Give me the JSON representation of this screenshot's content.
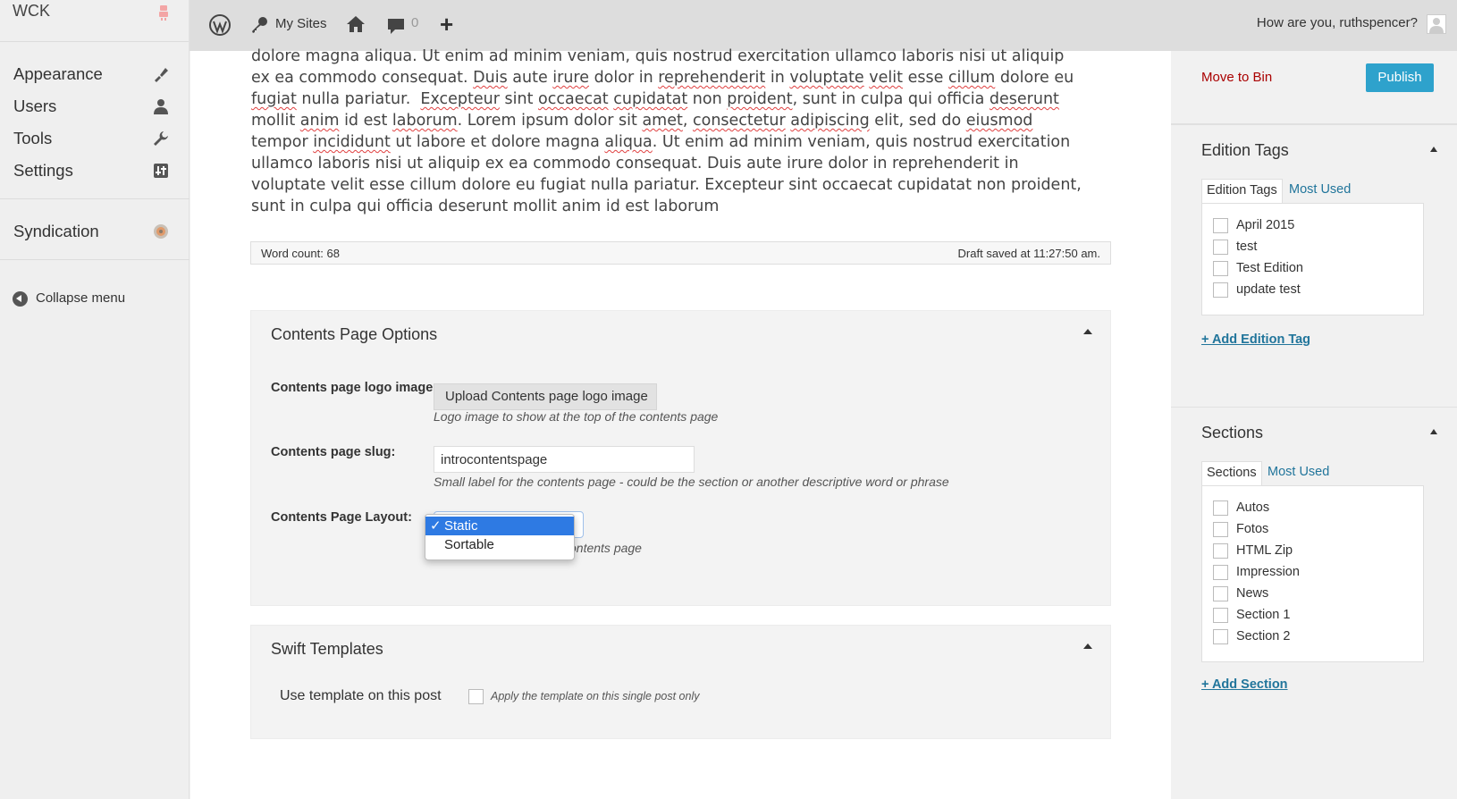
{
  "sidebar": {
    "top_label": "WCK",
    "items": [
      {
        "label": "Appearance",
        "icon": "paintbrush-icon"
      },
      {
        "label": "Users",
        "icon": "user-icon"
      },
      {
        "label": "Tools",
        "icon": "wrench-icon"
      },
      {
        "label": "Settings",
        "icon": "settings-icon"
      },
      {
        "label": "Syndication",
        "icon": "syndication-icon"
      }
    ],
    "collapse_label": "Collapse menu"
  },
  "topbar": {
    "my_sites": "My Sites",
    "comment_count": "0",
    "greeting": "How are you, ruthspencer?"
  },
  "editor": {
    "word_count": "Word count: 68",
    "draft_status": "Draft saved at 11:27:50 am."
  },
  "contents_options": {
    "title": "Contents Page Options",
    "logo_label": "Contents page logo image:",
    "logo_button": "Upload Contents page logo image",
    "logo_desc": "Logo image to show at the top of the contents page",
    "slug_label": "Contents page slug:",
    "slug_value": "introcontentspage",
    "slug_desc": "Small label for the contents page - could be the section or another descriptive word or phrase",
    "layout_label": "Contents Page Layout:",
    "layout_desc_visible": "ontents page",
    "layout_options": [
      "Static",
      "Sortable"
    ],
    "layout_selected": "Static"
  },
  "swift": {
    "title": "Swift Templates",
    "use_label": "Use template on this post",
    "desc": "Apply the template on this single post only"
  },
  "publish": {
    "move_to_bin": "Move to Bin",
    "publish_button": "Publish"
  },
  "edition_tags": {
    "title": "Edition Tags",
    "tab_active": "Edition Tags",
    "tab_other": "Most Used",
    "items": [
      "April 2015",
      "test",
      "Test Edition",
      "update test"
    ],
    "add_link": "+ Add Edition Tag"
  },
  "sections": {
    "title": "Sections",
    "tab_active": "Sections",
    "tab_other": "Most Used",
    "items": [
      "Autos",
      "Fotos",
      "HTML Zip",
      "Impression",
      "News",
      "Section 1",
      "Section 2"
    ],
    "add_link": "+ Add Section"
  },
  "colors": {
    "accent": "#2ea2cc",
    "link": "#21759b",
    "danger": "#aa0000",
    "select_highlight": "#2e7ae3"
  }
}
